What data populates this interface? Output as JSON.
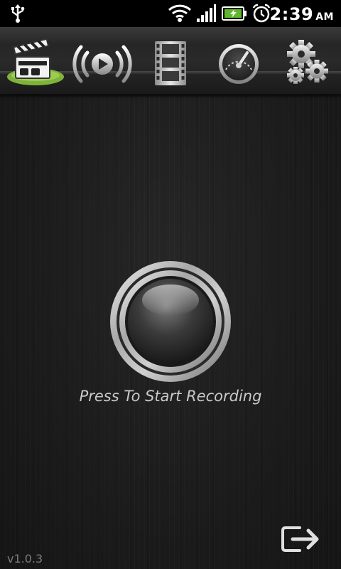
{
  "status_bar": {
    "time": "2:39",
    "ampm": "AM",
    "icons": [
      "usb-icon",
      "wifi-icon",
      "signal-icon",
      "battery-charging-icon",
      "alarm-icon"
    ]
  },
  "tabs": [
    {
      "name": "record",
      "icon": "clapperboard-icon",
      "selected": true
    },
    {
      "name": "stream",
      "icon": "broadcast-play-icon",
      "selected": false
    },
    {
      "name": "videos",
      "icon": "film-strip-icon",
      "selected": false
    },
    {
      "name": "quality",
      "icon": "gauge-icon",
      "selected": false
    },
    {
      "name": "settings",
      "icon": "gears-icon",
      "selected": false
    }
  ],
  "main": {
    "record_label": "Press To Start Recording",
    "version": "v1.0.3"
  },
  "colors": {
    "accent": "#7fb23a",
    "text": "#c9c9c9",
    "version": "#7c7c7c"
  }
}
